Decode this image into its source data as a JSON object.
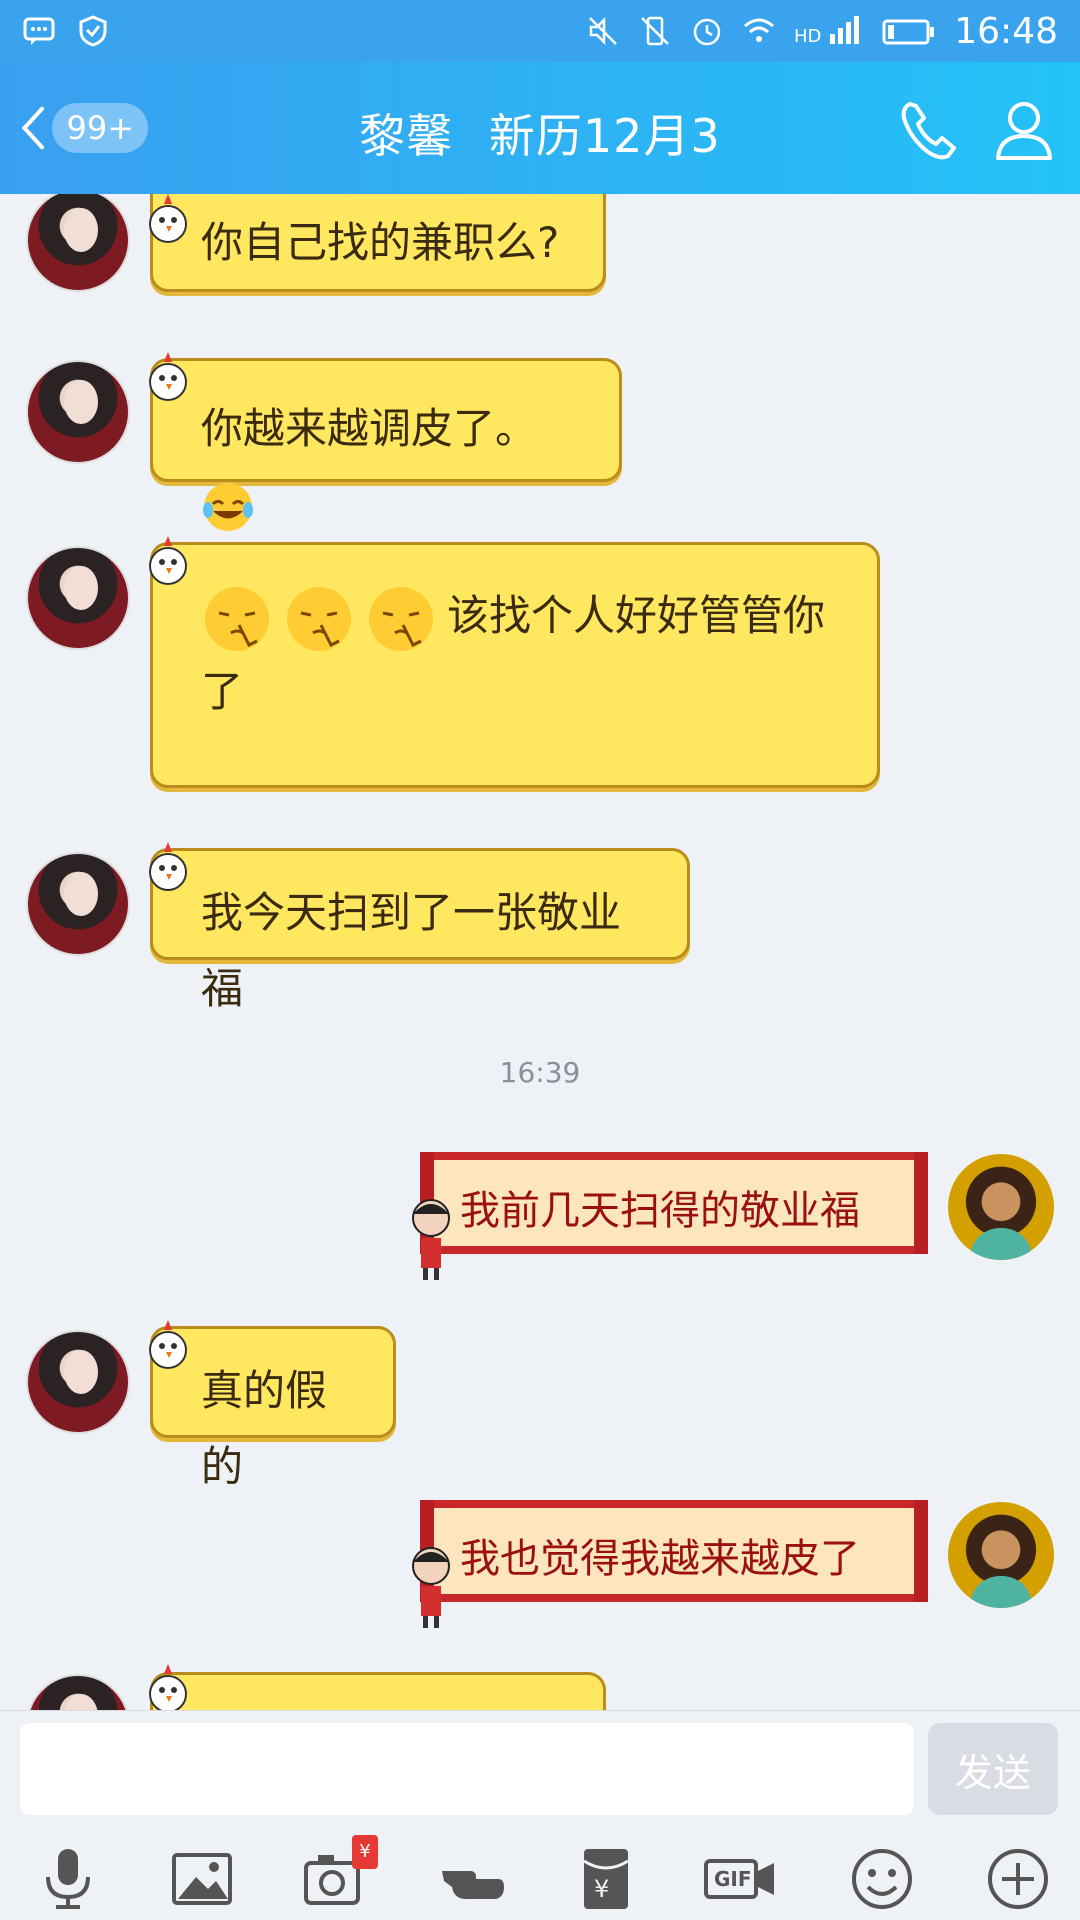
{
  "status_bar": {
    "time": "16:48",
    "icons": [
      "message-icon",
      "shield-icon",
      "mute-icon",
      "vibrate-off-icon",
      "alarm-icon",
      "wifi-icon",
      "hd-signal-icon",
      "battery-icon"
    ]
  },
  "header": {
    "back_badge": "99+",
    "name": "黎馨",
    "subtitle": "新历12月3",
    "icons": [
      "back-chevron-icon",
      "phone-icon",
      "profile-icon"
    ]
  },
  "messages": [
    {
      "side": "left",
      "text": "你自己找的兼职么?"
    },
    {
      "side": "left",
      "text": "你越来越调皮了。"
    },
    {
      "side": "left",
      "text": "该找个人好好管管你",
      "text2": "了"
    },
    {
      "side": "left",
      "text": "我今天扫到了一张敬业福"
    },
    {
      "side": "right",
      "text": "我前几天扫得的敬业福"
    },
    {
      "side": "left",
      "text": "真的假的"
    },
    {
      "side": "right",
      "text": "我也觉得我越来越皮了"
    }
  ],
  "timestamp": "16:39",
  "input": {
    "placeholder": "",
    "send_label": "发送"
  },
  "toolbar": {
    "icons": [
      "microphone-icon",
      "image-icon",
      "camera-redpacket-icon",
      "pointing-hand-icon",
      "red-envelope-icon",
      "gif-icon",
      "smiley-icon",
      "plus-icon"
    ],
    "red_tag": "¥",
    "gif_label": "GIF"
  },
  "colors": {
    "header_start": "#39a0f0",
    "header_end": "#24c2f7",
    "bubble_left": "#ffe760",
    "bubble_right": "#fde5c0",
    "bubble_right_text": "#9a0f10"
  }
}
